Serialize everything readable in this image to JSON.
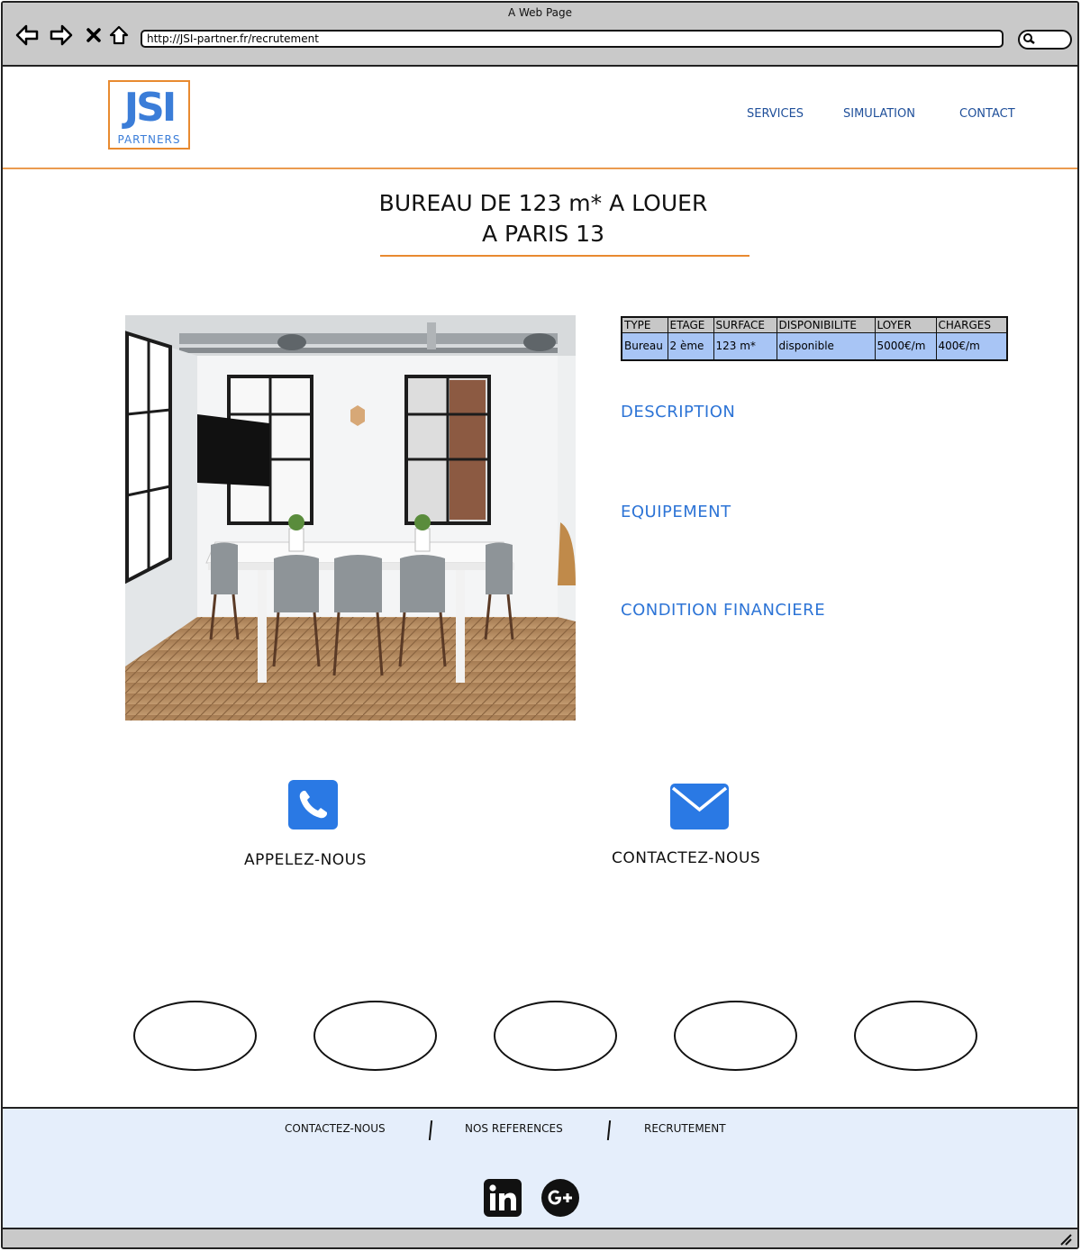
{
  "window": {
    "title": "A Web Page",
    "url": "http://JSI-partner.fr/recrutement"
  },
  "logo": {
    "main": "JSI",
    "sub": "PARTNERS"
  },
  "nav": {
    "services": "SERVICES",
    "simulation": "SIMULATION",
    "contact": "CONTACT"
  },
  "listing": {
    "title_line1": "BUREAU DE 123 m* A LOUER",
    "title_line2": "A PARIS 13"
  },
  "specs": {
    "headers": [
      "TYPE",
      "ETAGE",
      "SURFACE",
      "DISPONIBILITE",
      "LOYER",
      "CHARGES"
    ],
    "values": [
      "Bureau",
      "2 ème",
      "123 m*",
      "disponible",
      "5000€/m",
      "400€/m"
    ]
  },
  "sections": {
    "description": "DESCRIPTION",
    "equipment": "EQUIPEMENT",
    "financial": "CONDITION FINANCIERE"
  },
  "cta": {
    "call": "APPELEZ-NOUS",
    "contact": "CONTACTEZ-NOUS"
  },
  "footer": {
    "contact": "CONTACTEZ-NOUS",
    "references": "NOS REFERENCES",
    "recruitment": "RECRUTEMENT"
  },
  "icons": {
    "phone": "phone-icon",
    "mail": "envelope-icon",
    "linkedin": "linkedin-icon",
    "googleplus": "google-plus-icon"
  },
  "colors": {
    "accent_orange": "#e88a30",
    "accent_blue": "#2d74d6",
    "nav_blue": "#1f4f9a",
    "table_row": "#a8c5f5",
    "footer_bg": "#e5eefb"
  }
}
